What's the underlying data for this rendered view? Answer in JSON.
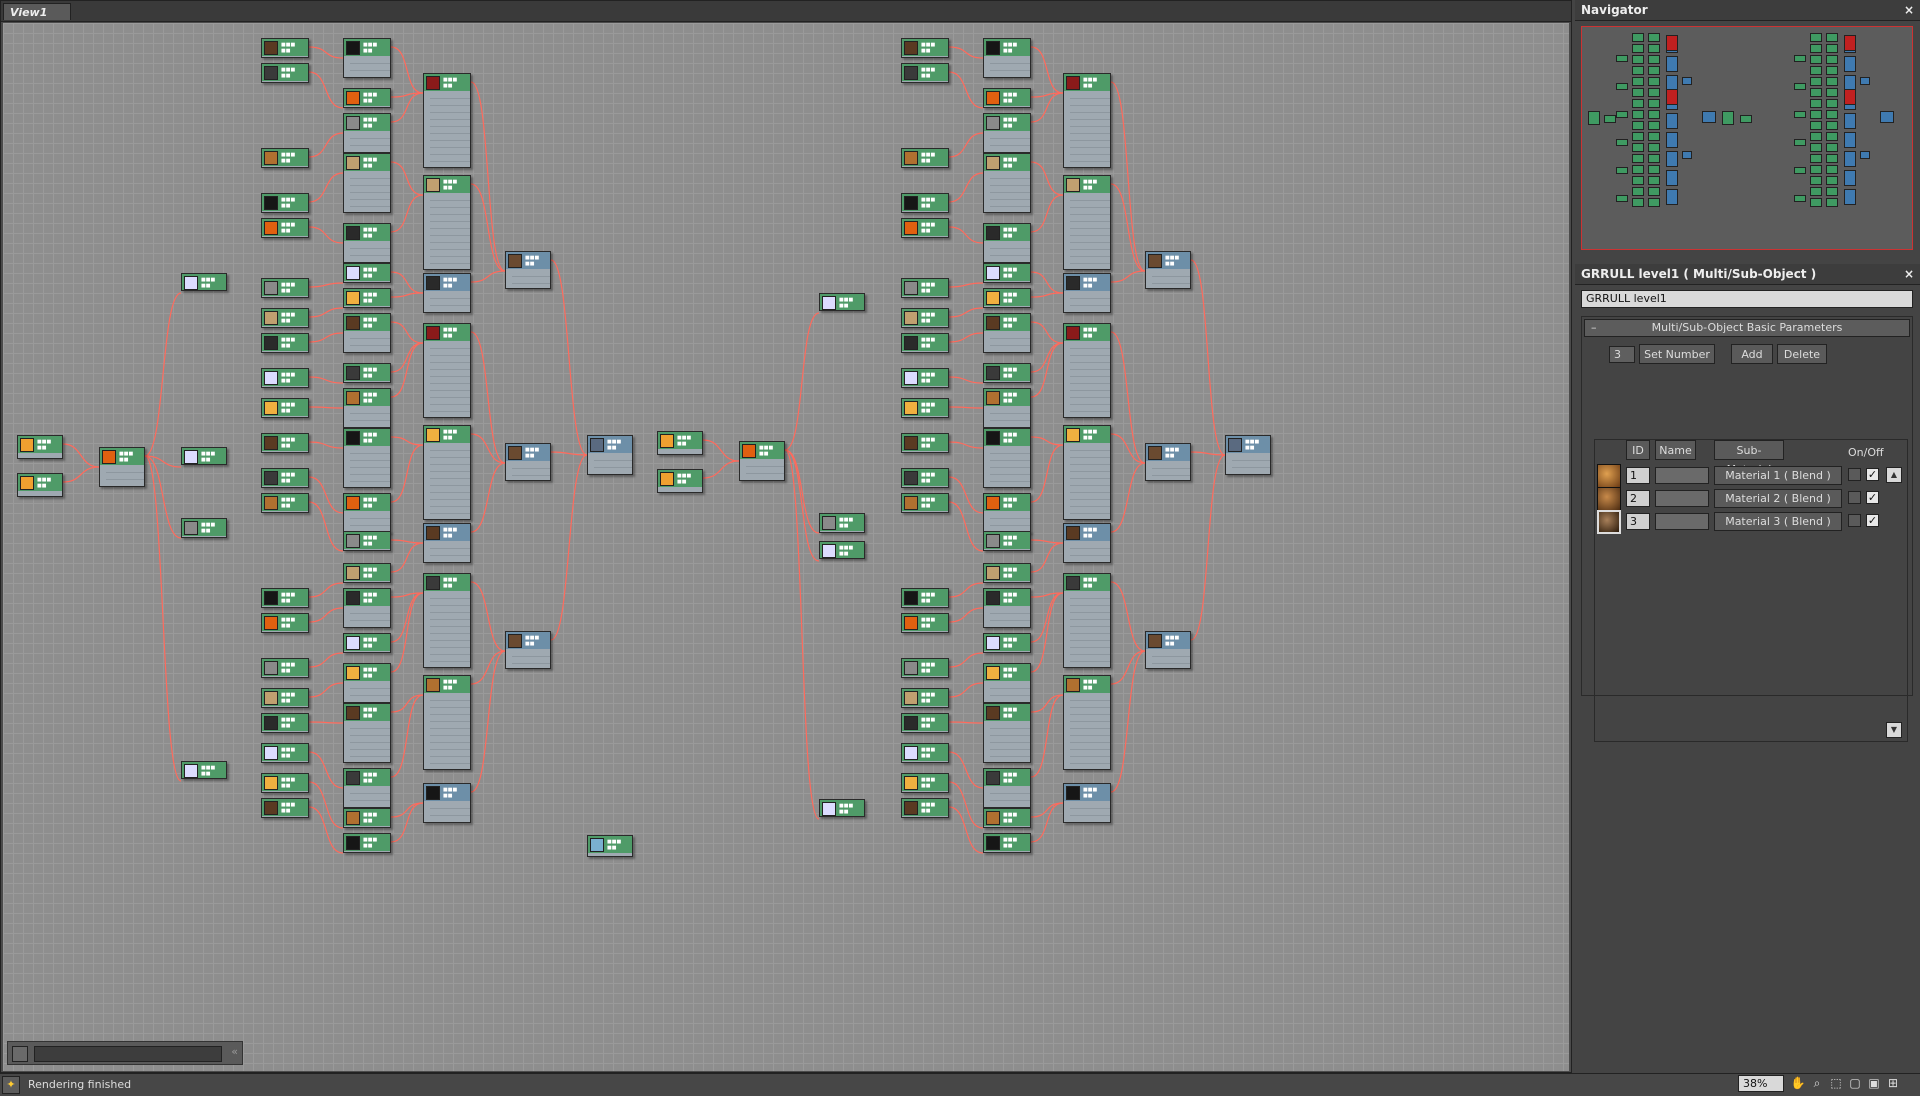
{
  "view": {
    "tab_label": "View1"
  },
  "canvas": {
    "background": "#8e8e8e",
    "wire_color": "#ff6a5c",
    "map_header": "#4f9b68",
    "material_header": "#6d8fa8"
  },
  "navigator": {
    "title": "Navigator",
    "close_icon": "close-icon"
  },
  "properties": {
    "title": "GRRULL level1  ( Multi/Sub-Object )",
    "name_value": "GRRULL level1",
    "rollout_title": "Multi/Sub-Object Basic Parameters",
    "count_value": "3",
    "set_number_label": "Set Number",
    "add_label": "Add",
    "delete_label": "Delete",
    "columns": {
      "id": "ID",
      "name": "Name",
      "sub_material": "Sub-Material",
      "on_off": "On/Off"
    },
    "rows": [
      {
        "id": "1",
        "name": "",
        "sub_material": "Material 1  ( Blend )",
        "checked": true
      },
      {
        "id": "2",
        "name": "",
        "sub_material": "Material 2  ( Blend )",
        "checked": true
      },
      {
        "id": "3",
        "name": "",
        "sub_material": "Material 3  ( Blend )",
        "checked": true
      }
    ]
  },
  "status": {
    "message": "Rendering finished",
    "zoom": "38%"
  }
}
